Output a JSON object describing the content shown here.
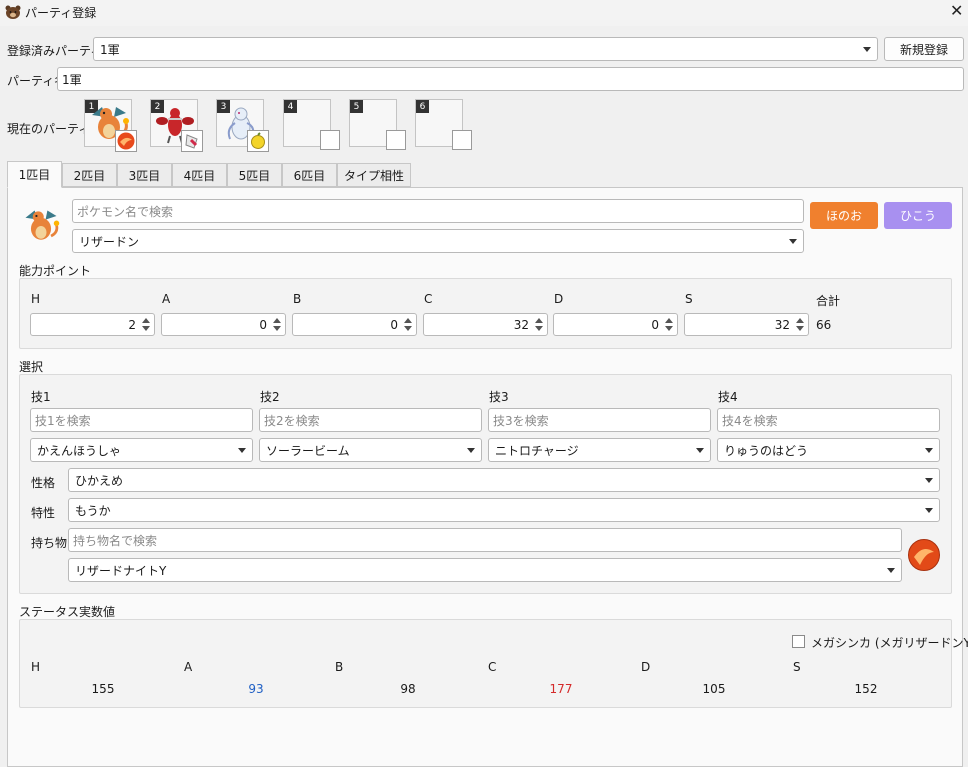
{
  "window": {
    "title": "パーティ登録"
  },
  "party_select": {
    "label": "登録済みパーティ",
    "value": "1軍",
    "new_button": "新規登録"
  },
  "party_name": {
    "label": "パーティ名",
    "value": "1軍"
  },
  "current_party": {
    "label": "現在のパーティ",
    "slots": [
      {
        "num": "1",
        "pokemon": "リザードン",
        "has_item": true
      },
      {
        "num": "2",
        "pokemon": "scizor",
        "has_item": true
      },
      {
        "num": "3",
        "pokemon": "white-pokemon",
        "has_item": true
      },
      {
        "num": "4",
        "pokemon": "",
        "has_item": false
      },
      {
        "num": "5",
        "pokemon": "",
        "has_item": false
      },
      {
        "num": "6",
        "pokemon": "",
        "has_item": false
      }
    ]
  },
  "tabs": [
    "1匹目",
    "2匹目",
    "3匹目",
    "4匹目",
    "5匹目",
    "6匹目",
    "タイプ相性"
  ],
  "active_tab": 0,
  "pokemon": {
    "search_placeholder": "ポケモン名で検索",
    "selected": "リザードン",
    "types": [
      {
        "label": "ほのお",
        "color": "#f0802e"
      },
      {
        "label": "ひこう",
        "color": "#a890f0"
      }
    ]
  },
  "ability_points": {
    "section_label": "能力ポイント",
    "stats": [
      {
        "label": "H",
        "value": "2"
      },
      {
        "label": "A",
        "value": "0"
      },
      {
        "label": "B",
        "value": "0"
      },
      {
        "label": "C",
        "value": "32"
      },
      {
        "label": "D",
        "value": "0"
      },
      {
        "label": "S",
        "value": "32"
      }
    ],
    "total_label": "合計",
    "total_value": "66"
  },
  "selection": {
    "section_label": "選択",
    "moves": [
      {
        "label": "技1",
        "placeholder": "技1を検索",
        "value": "かえんほうしゃ"
      },
      {
        "label": "技2",
        "placeholder": "技2を検索",
        "value": "ソーラービーム"
      },
      {
        "label": "技3",
        "placeholder": "技3を検索",
        "value": "ニトロチャージ"
      },
      {
        "label": "技4",
        "placeholder": "技4を検索",
        "value": "りゅうのはどう"
      }
    ],
    "nature_label": "性格",
    "nature_value": "ひかえめ",
    "ability_label": "特性",
    "ability_value": "もうか",
    "item_label": "持ち物",
    "item_placeholder": "持ち物名で検索",
    "item_value": "リザードナイトY"
  },
  "status": {
    "section_label": "ステータス実数値",
    "mega_label": "メガシンカ (メガリザードンY)",
    "mega_checked": false,
    "stats": [
      {
        "label": "H",
        "value": "155",
        "color": "#1a1a1a"
      },
      {
        "label": "A",
        "value": "93",
        "color": "#1f5fc4"
      },
      {
        "label": "B",
        "value": "98",
        "color": "#1a1a1a"
      },
      {
        "label": "C",
        "value": "177",
        "color": "#d42a2a"
      },
      {
        "label": "D",
        "value": "105",
        "color": "#1a1a1a"
      },
      {
        "label": "S",
        "value": "152",
        "color": "#1a1a1a"
      }
    ]
  }
}
